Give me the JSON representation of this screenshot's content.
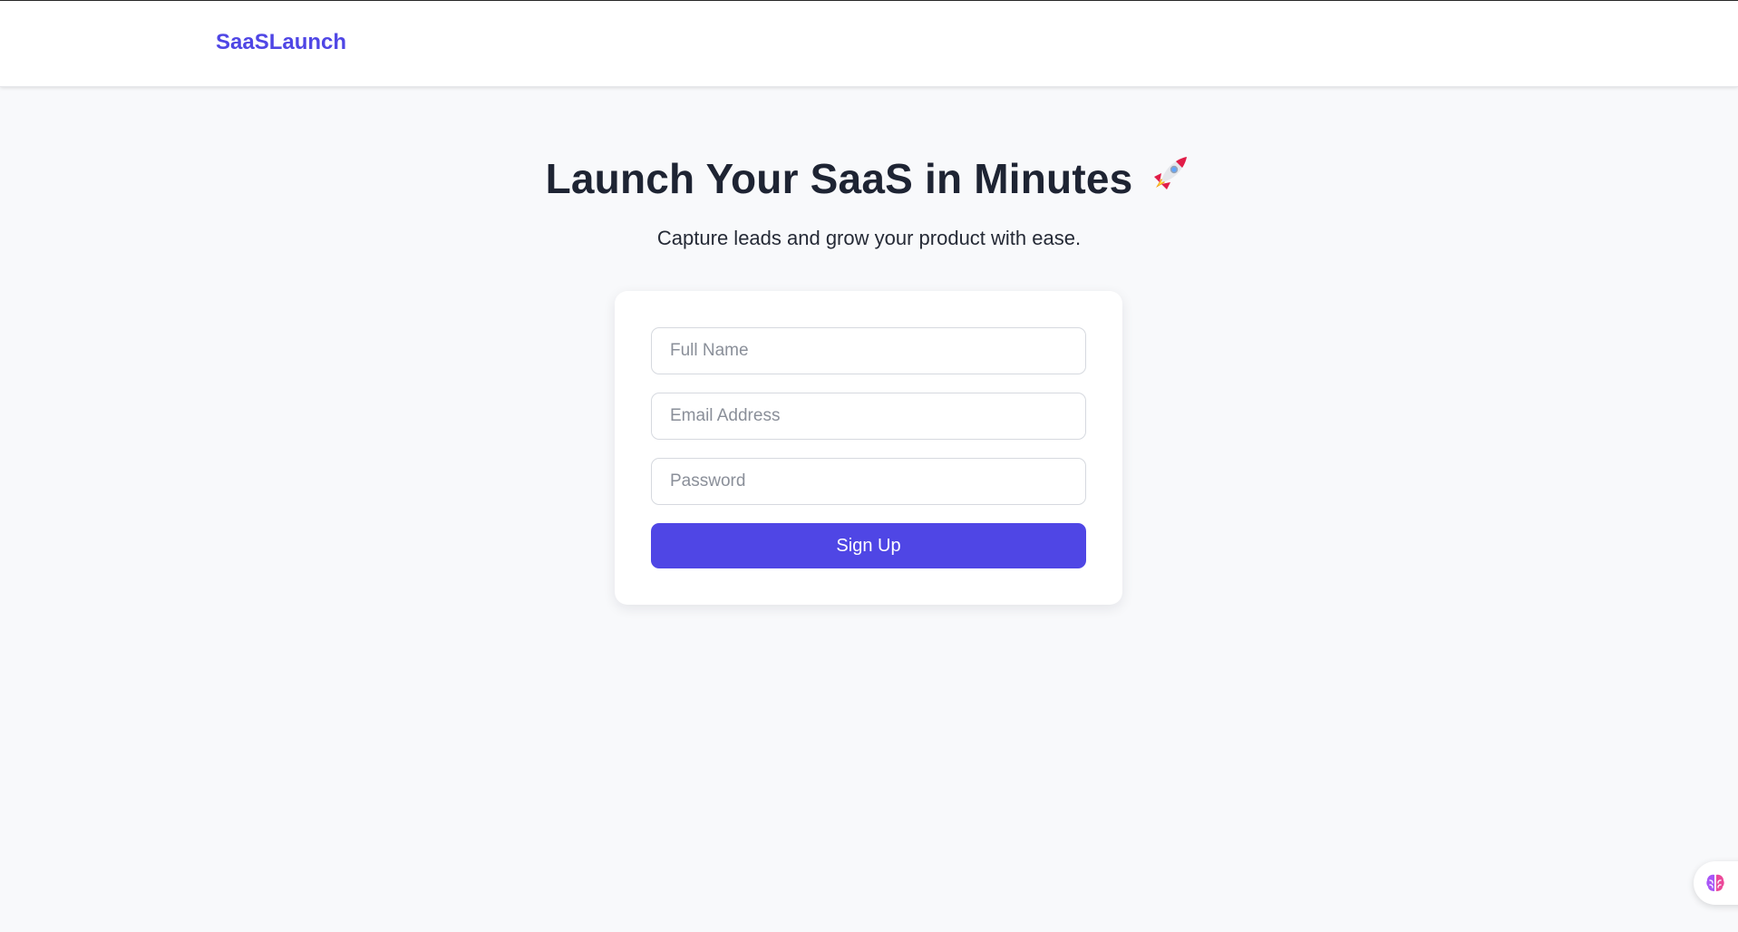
{
  "nav": {
    "brand": "SaaSLaunch"
  },
  "hero": {
    "title": "Launch Your SaaS in Minutes",
    "title_icon": "rocket-emoji",
    "subtitle": "Capture leads and grow your product with ease."
  },
  "form": {
    "name_placeholder": "Full Name",
    "name_value": "",
    "email_placeholder": "Email Address",
    "email_value": "",
    "password_placeholder": "Password",
    "password_value": "",
    "submit_label": "Sign Up"
  },
  "floating_widget": {
    "icon": "brain-icon"
  },
  "colors": {
    "accent": "#4f46e5",
    "page_background": "#f8f9fb",
    "heading": "#1e2433"
  }
}
